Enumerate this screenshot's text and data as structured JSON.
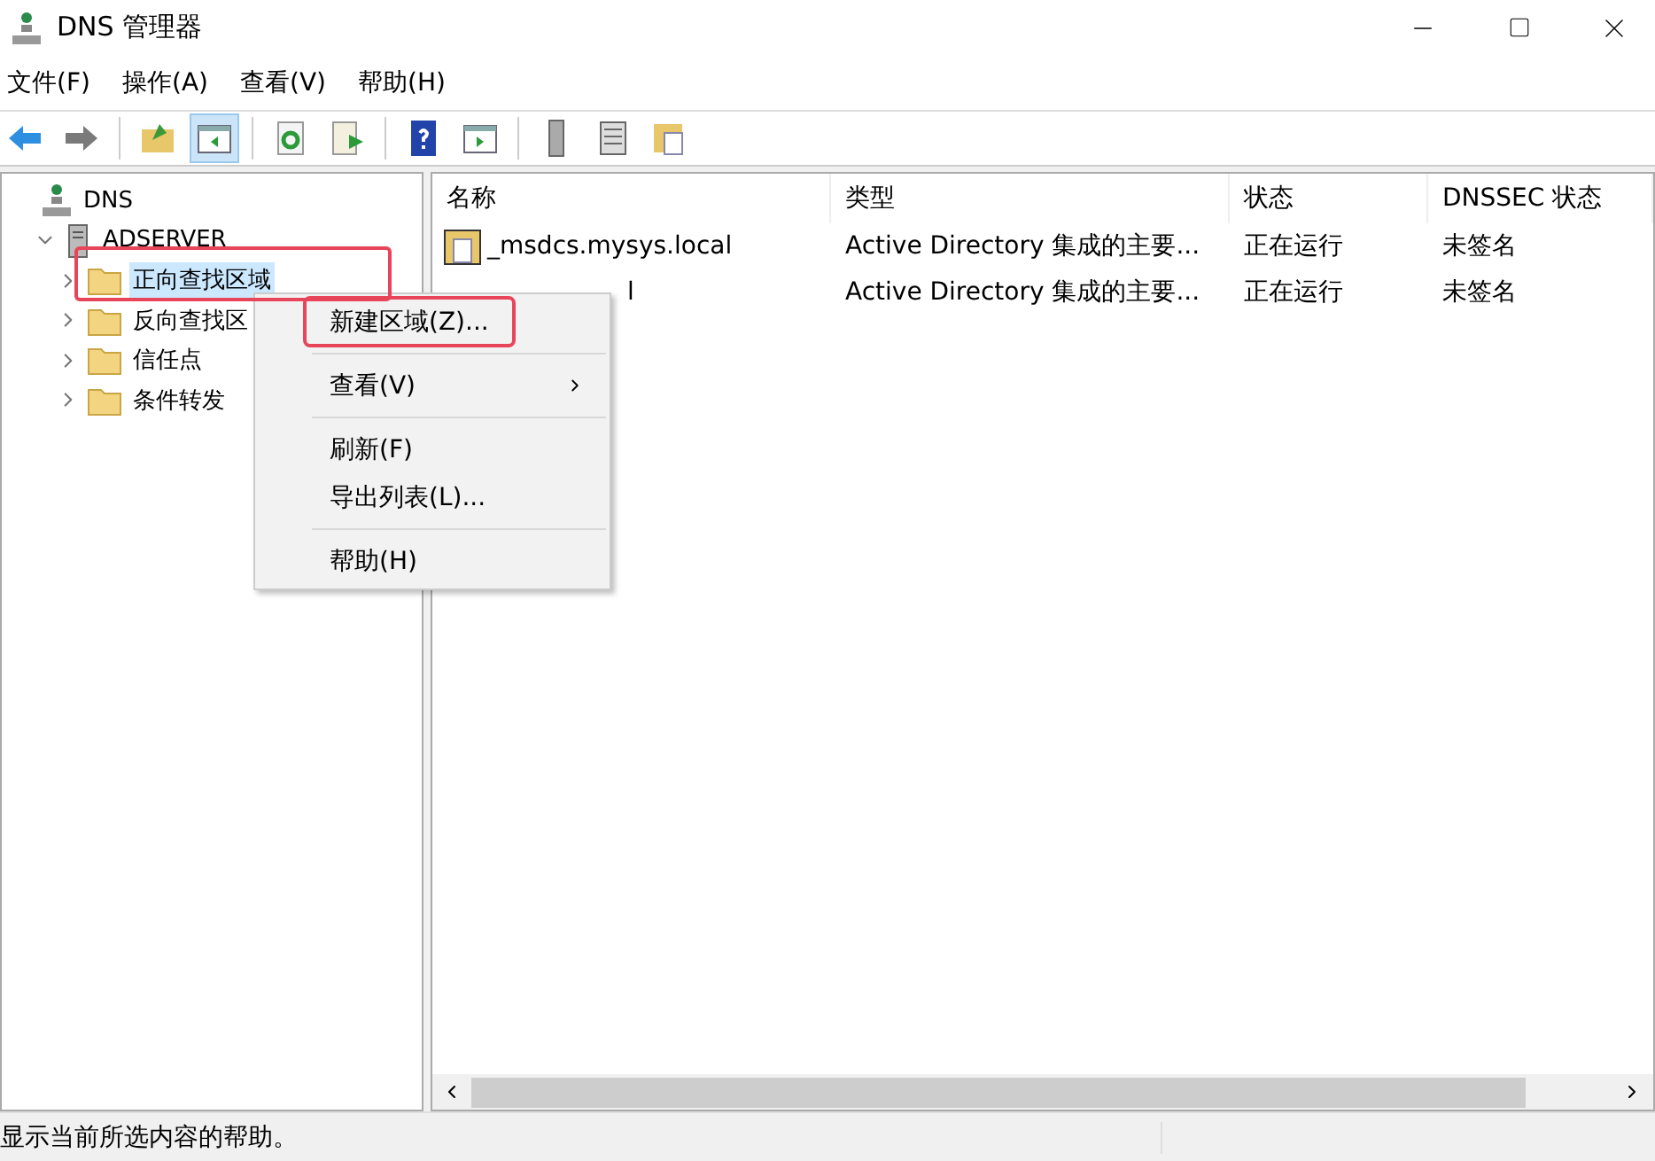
{
  "window": {
    "title": "DNS 管理器"
  },
  "menu_bar": [
    "文件(F)",
    "操作(A)",
    "查看(V)",
    "帮助(H)"
  ],
  "toolbar": [
    {
      "kind": "back"
    },
    {
      "kind": "forward"
    },
    {
      "kind": "sep"
    },
    {
      "kind": "up"
    },
    {
      "kind": "pane",
      "selected": true
    },
    {
      "kind": "sep"
    },
    {
      "kind": "refresh"
    },
    {
      "kind": "export"
    },
    {
      "kind": "sep"
    },
    {
      "kind": "help"
    },
    {
      "kind": "pane2"
    },
    {
      "kind": "sep"
    },
    {
      "kind": "server"
    },
    {
      "kind": "list"
    },
    {
      "kind": "zones"
    }
  ],
  "tree": [
    {
      "label": "DNS",
      "kind": "root",
      "children": [
        {
          "label": "ADSERVER",
          "kind": "server",
          "expanded": true,
          "children": [
            {
              "label": "正向查找区域",
              "kind": "folder",
              "selected": true,
              "expanded": false
            },
            {
              "label": "反向查找区",
              "kind": "folder",
              "selected": false,
              "expanded": false
            },
            {
              "label": "信任点",
              "kind": "folder",
              "selected": false,
              "expanded": false
            },
            {
              "label": "条件转发",
              "kind": "folder",
              "selected": false,
              "expanded": false
            }
          ]
        }
      ]
    }
  ],
  "table": {
    "columns": [
      "名称",
      "类型",
      "状态",
      "DNSSEC 状态"
    ],
    "rows": [
      {
        "name": "_msdcs.mysys.local",
        "covered": false,
        "type": "Active Directory 集成的主要...",
        "status": "正在运行",
        "dnssec": "未签名"
      },
      {
        "name": "l",
        "covered": true,
        "type": "Active Directory 集成的主要...",
        "status": "正在运行",
        "dnssec": "未签名"
      }
    ]
  },
  "context_menu": {
    "groups": [
      [
        {
          "label": "新建区域(Z)...",
          "submenu": false,
          "highlighted": true
        }
      ],
      [
        {
          "label": "查看(V)",
          "submenu": true,
          "highlighted": false
        }
      ],
      [
        {
          "label": "刷新(F)",
          "submenu": false,
          "highlighted": false
        },
        {
          "label": "导出列表(L)...",
          "submenu": false,
          "highlighted": false
        }
      ],
      [
        {
          "label": "帮助(H)",
          "submenu": false,
          "highlighted": false
        }
      ]
    ]
  },
  "status_bar": "显示当前所选内容的帮助。"
}
